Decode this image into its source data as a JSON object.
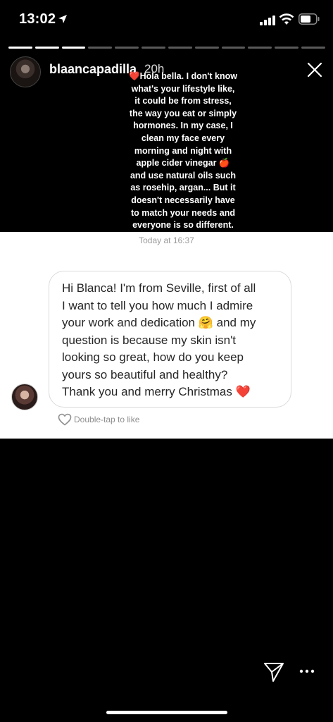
{
  "status_bar": {
    "time": "13:02"
  },
  "progress": {
    "total_segments": 12,
    "completed_segments": 3
  },
  "story": {
    "username": "blaancapadilla",
    "time_ago": "20h",
    "text_lines": [
      "Hola bella. I don't know",
      "what's your lifestyle like,",
      "it could be from stress,",
      "the way you eat or simply",
      "hormones. In my case, I",
      "clean my face every",
      "morning and night with",
      "apple cider vinegar",
      "and use natural oils such",
      "as rosehip, argan... But it",
      "doesn't necessarily have",
      "to match your needs and",
      "everyone is so different."
    ],
    "text_emoji_1": "❤️",
    "text_emoji_2": "🍎"
  },
  "question": {
    "timestamp": "Today at 16:37",
    "message_lines": [
      "Hi Blanca! I'm from Seville, first of all",
      "I want to tell you how much I admire",
      "your work and dedication 🤗 and my",
      "question is because my skin isn't",
      "looking so great, how do you keep",
      "yours so beautiful and healthy?",
      "Thank you and merry Christmas ❤️"
    ],
    "like_hint": "Double-tap to like"
  },
  "icons": {
    "location": "location-arrow-icon",
    "signal": "signal-icon",
    "wifi": "wifi-icon",
    "battery": "battery-icon",
    "close": "close-icon",
    "heart": "heart-outline-icon",
    "send": "send-icon",
    "more": "more-icon"
  }
}
